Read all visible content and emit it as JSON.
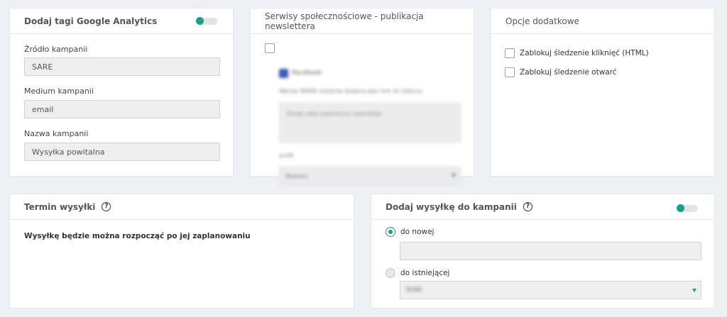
{
  "ga_card": {
    "title": "Dodaj tagi Google Analytics",
    "fields": [
      {
        "label": "Źródło kampanii",
        "value": "SARE"
      },
      {
        "label": "Medium kampanii",
        "value": "email"
      },
      {
        "label": "Nazwa kampanii",
        "value": "Wysyłka powitalna"
      }
    ]
  },
  "social_card": {
    "title": "Serwisy społecznościowe - publikacja newslettera",
    "facebook_label": "Facebook",
    "hint": "Wersja WWW zostanie dodana jako link do statusu",
    "status_placeholder": "Dodaj swój tajemniczy newsletter",
    "profile_label": "profil",
    "profile_value": "Wybierz"
  },
  "options_card": {
    "title": "Opcje dodatkowe",
    "options": [
      {
        "label": "Zablokuj śledzenie kliknięć (HTML)"
      },
      {
        "label": "Zablokuj śledzenie otwarć"
      }
    ]
  },
  "schedule_card": {
    "title": "Termin wysyłki",
    "message": "Wysyłkę będzie można rozpocząć po jej zaplanowaniu"
  },
  "campaign_card": {
    "title": "Dodaj wysyłkę do kampanii",
    "radio_new": "do nowej",
    "radio_existing": "do istniejącej",
    "existing_value": "brak"
  },
  "colors": {
    "accent": "#17a085",
    "background": "#eef0f3"
  }
}
